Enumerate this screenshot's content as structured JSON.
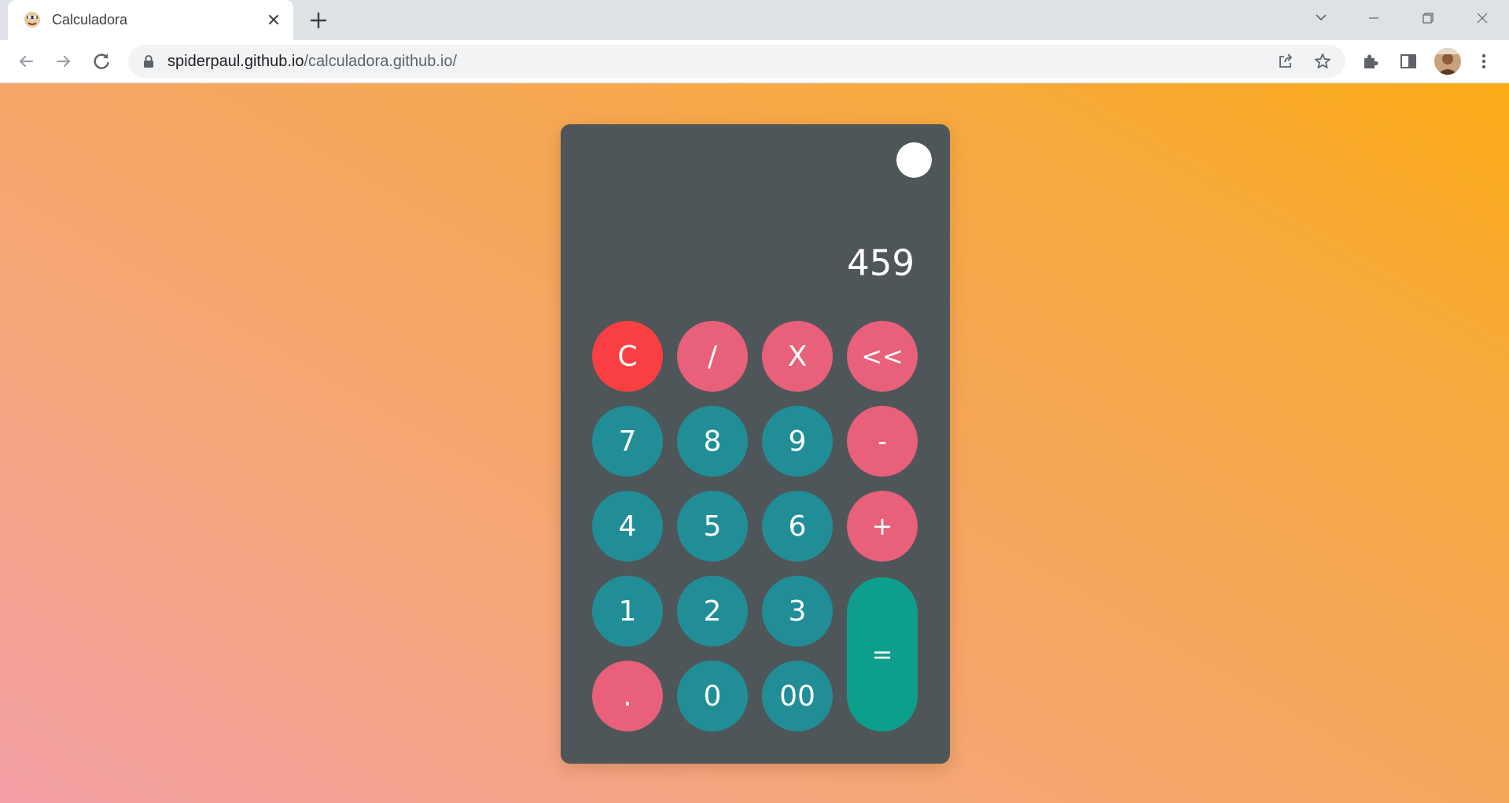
{
  "browser": {
    "tab": {
      "title": "Calculadora",
      "favicon": "calculator-favicon"
    },
    "url": {
      "host": "spiderpaul.github.io",
      "path": "/calculadora.github.io/"
    },
    "icons": {
      "back": "arrow-left-icon",
      "forward": "arrow-right-icon",
      "reload": "reload-icon",
      "lock": "lock-icon",
      "share": "share-icon",
      "bookmark": "star-icon",
      "extensions": "puzzle-icon",
      "side_panel": "side-panel-icon",
      "menu": "kebab-menu-icon"
    }
  },
  "calculator": {
    "display": "459",
    "keys": {
      "clear": "C",
      "divide": "/",
      "multiply": "X",
      "backspace": "<<",
      "seven": "7",
      "eight": "8",
      "nine": "9",
      "minus": "-",
      "four": "4",
      "five": "5",
      "six": "6",
      "plus": "+",
      "one": "1",
      "two": "2",
      "three": "3",
      "equals": "=",
      "dot": ".",
      "zero": "0",
      "double_zero": "00"
    },
    "colors": {
      "body": "#4f5659",
      "number_key": "#218e97",
      "operator_key": "#e8607a",
      "clear_key": "#f93f42",
      "equals_key": "#0e9f8c",
      "toggle": "#ffffff"
    }
  }
}
